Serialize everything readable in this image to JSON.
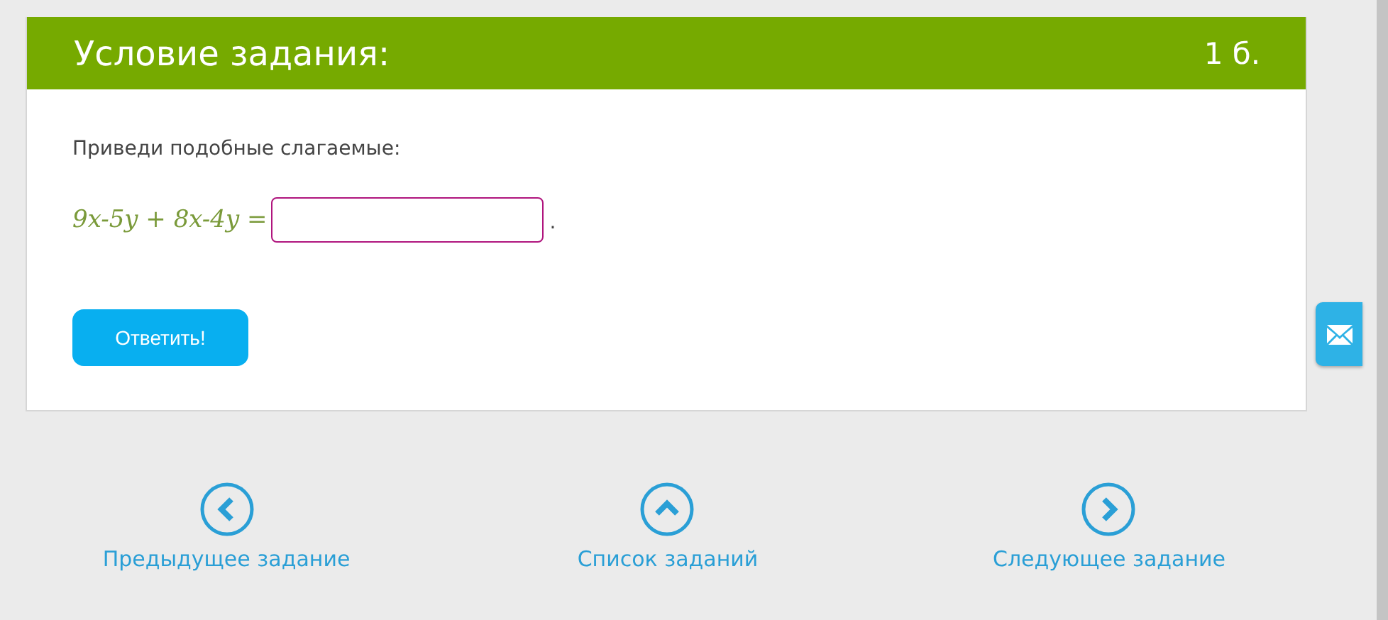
{
  "task": {
    "title": "Условие задания:",
    "points": "1 б.",
    "instruction": "Приведи подобные слагаемые:",
    "equation": "9x-5y + 8x-4y =",
    "trailing": ".",
    "submit": "Ответить!"
  },
  "navigation": [
    {
      "kind": "prev",
      "label": "Предыдущее задание"
    },
    {
      "kind": "list",
      "label": "Список заданий"
    },
    {
      "kind": "next",
      "label": "Следующее задание"
    }
  ]
}
